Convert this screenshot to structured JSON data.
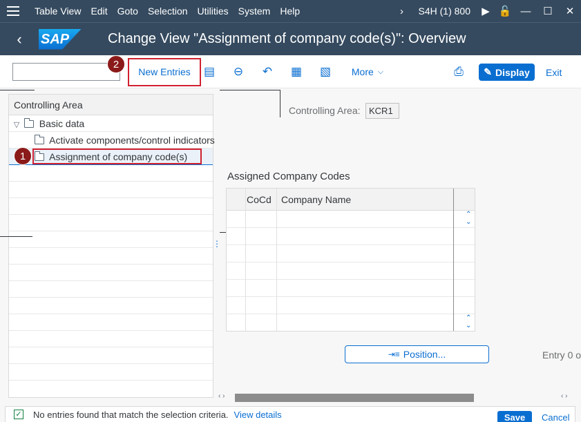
{
  "menubar": {
    "items": [
      "Table View",
      "Edit",
      "Goto",
      "Selection",
      "Utilities",
      "System",
      "Help"
    ],
    "system": "S4H (1) 800"
  },
  "titlebar": {
    "logo": "SAP",
    "title": "Change View \"Assignment of company code(s)\": Overview"
  },
  "toolbar": {
    "new_entries": "New Entries",
    "more": "More",
    "display": "Display",
    "exit": "Exit",
    "command_value": ""
  },
  "callouts": {
    "one": "1",
    "two": "2"
  },
  "tree": {
    "header": "Controlling Area",
    "items": [
      {
        "label": "Basic data",
        "level": 0,
        "expanded": true
      },
      {
        "label": "Activate components/control indicators",
        "level": 1
      },
      {
        "label": "Assignment of company code(s)",
        "level": 1,
        "selected": true
      }
    ]
  },
  "detail": {
    "controlling_area_label": "Controlling Area:",
    "controlling_area_value": "KCR1",
    "section_title": "Assigned Company Codes",
    "columns": [
      "CoCd",
      "Company Name"
    ],
    "position_button": "Position...",
    "entry_text": "Entry 0 o"
  },
  "status": {
    "message": "No entries found that match the selection criteria.",
    "link": "View details",
    "save": "Save",
    "cancel": "Cancel"
  }
}
